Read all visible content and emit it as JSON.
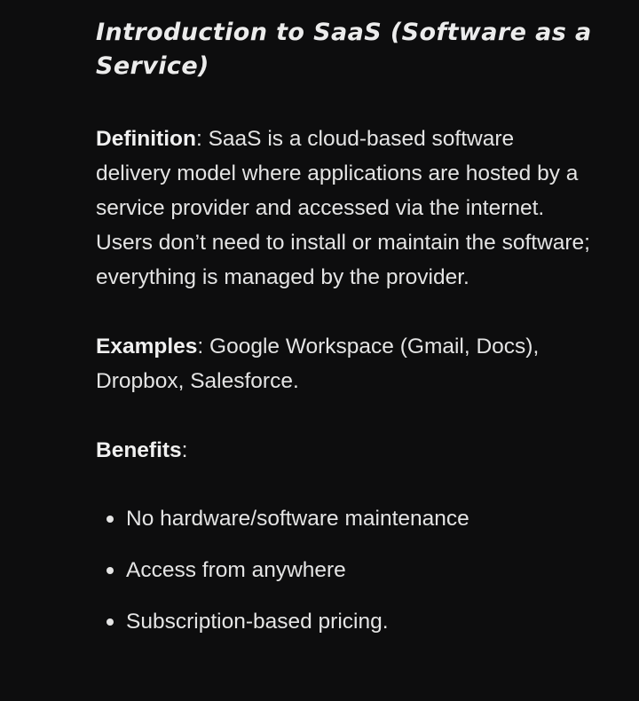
{
  "article": {
    "title": "Introduction to SaaS (Software as a Service)",
    "definition": {
      "lead": "Definition",
      "sep": ": ",
      "text": "SaaS is a cloud-based software delivery model where applications are hosted by a service provider and accessed via the internet. Users don’t need to install or maintain the software; everything is managed by the provider."
    },
    "examples": {
      "lead": "Examples",
      "sep": ": ",
      "text": "Google Workspace (Gmail, Docs), Dropbox, Salesforce."
    },
    "benefits": {
      "lead": "Benefits",
      "sep": ":",
      "items": [
        "No hardware/software maintenance",
        "Access from anywhere",
        "Subscription-based pricing."
      ]
    }
  },
  "colors": {
    "background": "#0d0d0e",
    "text": "#e4e4e4"
  }
}
